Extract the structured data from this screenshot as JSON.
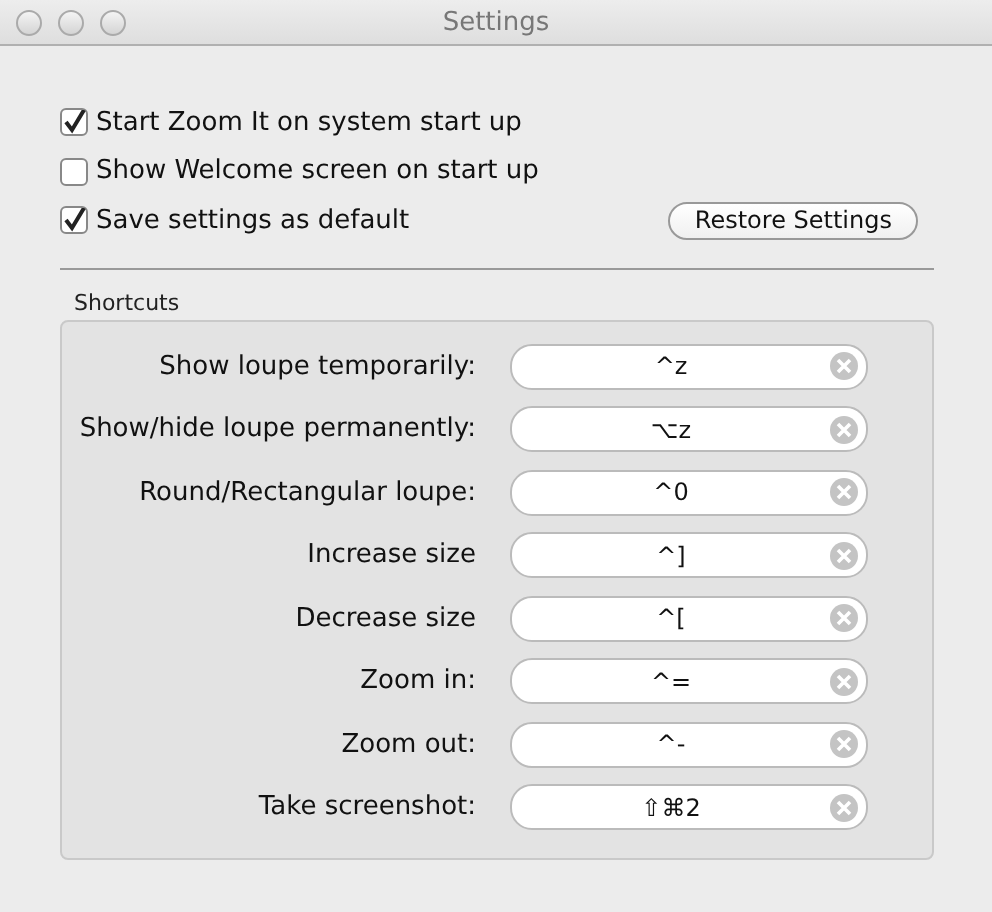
{
  "window": {
    "title": "Settings"
  },
  "options": [
    {
      "label": "Start Zoom It on system start up",
      "checked": true
    },
    {
      "label": "Show Welcome screen on start up",
      "checked": false
    },
    {
      "label": "Save settings as default",
      "checked": true
    }
  ],
  "restore_button": "Restore Settings",
  "shortcuts": {
    "title": "Shortcuts",
    "rows": [
      {
        "label": "Show loupe temporarily:",
        "value": "^z"
      },
      {
        "label": "Show/hide loupe permanently:",
        "value": "⌥z"
      },
      {
        "label": "Round/Rectangular loupe:",
        "value": "^0"
      },
      {
        "label": "Increase size",
        "value": "^]"
      },
      {
        "label": "Decrease size",
        "value": "^["
      },
      {
        "label": "Zoom in:",
        "value": "^="
      },
      {
        "label": "Zoom out:",
        "value": "^-"
      },
      {
        "label": "Take screenshot:",
        "value": "⇧⌘2"
      }
    ]
  }
}
